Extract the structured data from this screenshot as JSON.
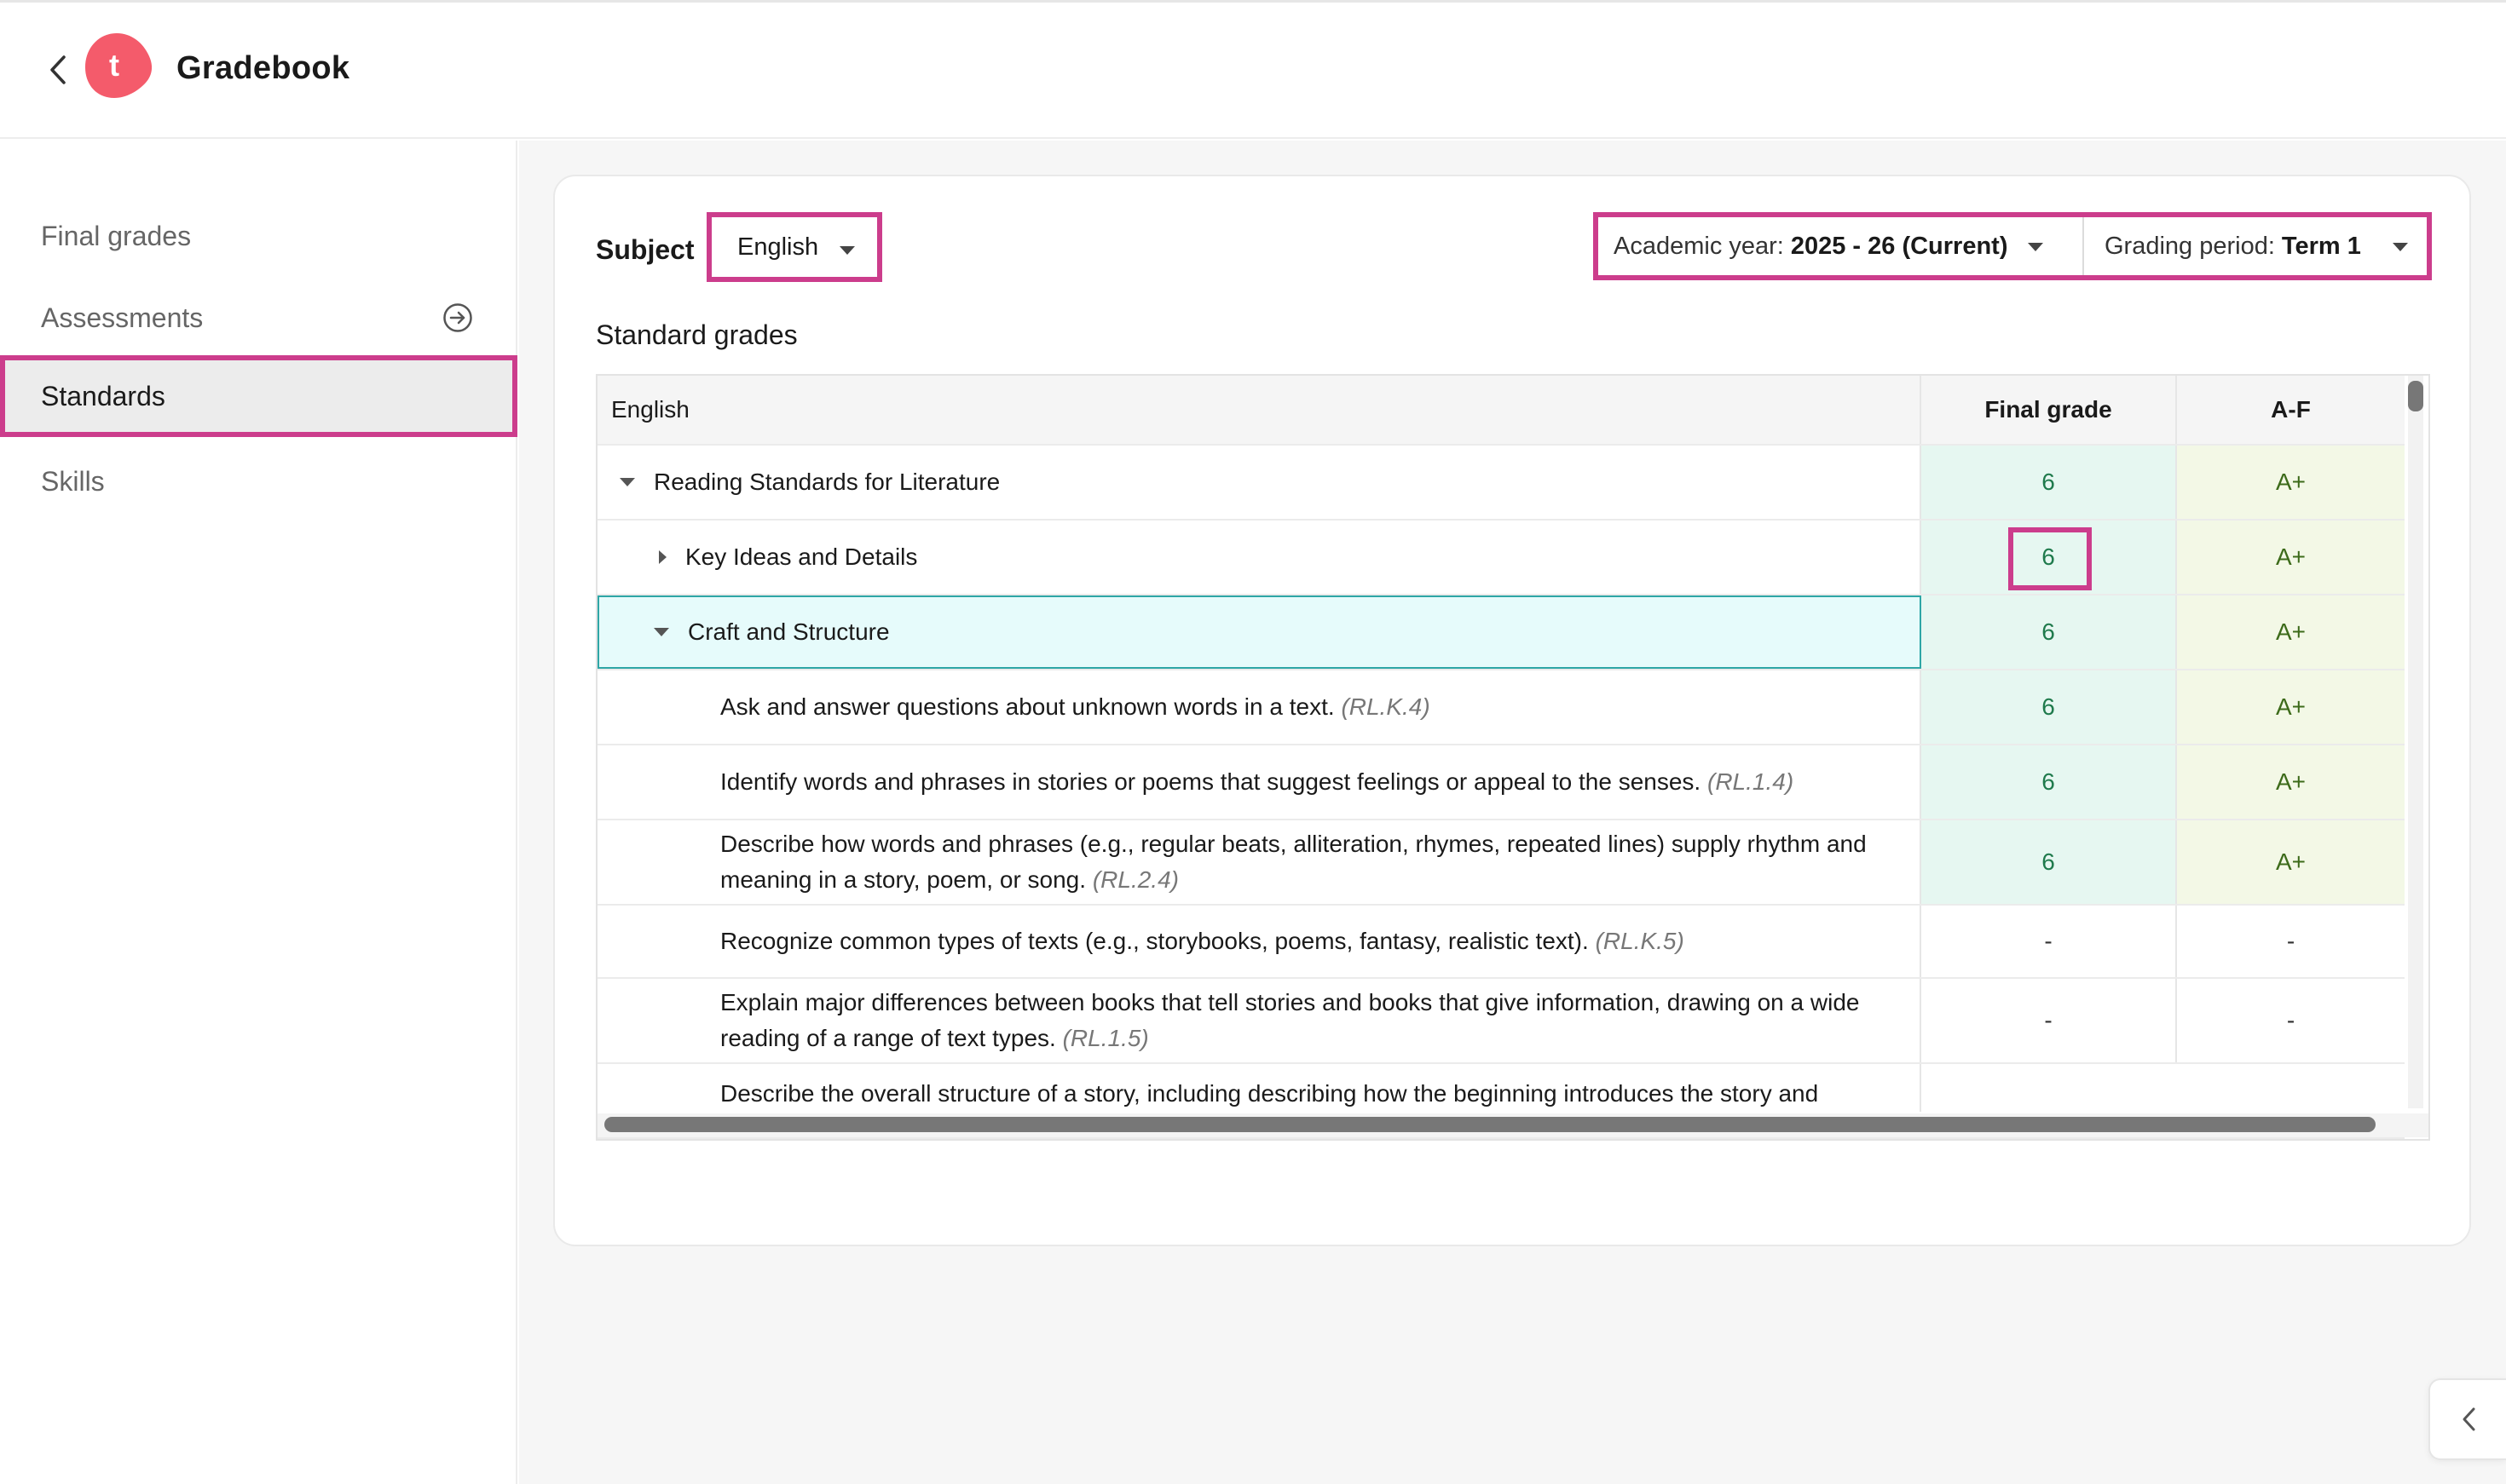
{
  "header": {
    "title": "Gradebook",
    "logo_letter": "t",
    "brand_color": "#f45b6b"
  },
  "sidebar": {
    "items": [
      {
        "label": "Final grades"
      },
      {
        "label": "Assessments",
        "icon": "arrow-right-circle-icon"
      },
      {
        "label": "Standards",
        "active": true
      },
      {
        "label": "Skills"
      }
    ]
  },
  "filters": {
    "subject_label": "Subject",
    "subject_value": "English",
    "academic_year_label": "Academic year:",
    "academic_year_value": "2025 - 26 (Current)",
    "grading_period_label": "Grading period:",
    "grading_period_value": "Term 1"
  },
  "section_title": "Standard grades",
  "table": {
    "headers": {
      "name": "English",
      "final": "Final grade",
      "af": "A-F"
    },
    "rows": [
      {
        "text": "Reading Standards for Literature",
        "code": "",
        "final": "6",
        "af": "A+"
      },
      {
        "text": "Key Ideas and Details",
        "code": "",
        "final": "6",
        "af": "A+"
      },
      {
        "text": "Craft and Structure",
        "code": "",
        "final": "6",
        "af": "A+"
      },
      {
        "text": "Ask and answer questions about unknown words in a text.",
        "code": "(RL.K.4)",
        "final": "6",
        "af": "A+"
      },
      {
        "text": "Identify words and phrases in stories or poems that suggest feelings or appeal to the senses.",
        "code": "(RL.1.4)",
        "final": "6",
        "af": "A+"
      },
      {
        "text": "Describe how words and phrases (e.g., regular beats, alliteration, rhymes, repeated lines) supply rhythm and meaning in a story, poem, or song.",
        "code": "(RL.2.4)",
        "final": "6",
        "af": "A+"
      },
      {
        "text": "Recognize common types of texts (e.g., storybooks, poems, fantasy, realistic text).",
        "code": "(RL.K.5)",
        "final": "-",
        "af": "-"
      },
      {
        "text": "Explain major differences between books that tell stories and books that give information, drawing on a wide reading of a range of text types.",
        "code": "(RL.1.5)",
        "final": "-",
        "af": "-"
      },
      {
        "text": "Describe the overall structure of a story, including describing how the beginning introduces the story and",
        "code": "",
        "final": "",
        "af": ""
      }
    ]
  },
  "colors": {
    "highlight": "#cc3d8c",
    "grade_bg": "#e6f7f1",
    "af_bg": "#f3f8e6",
    "selected_row": "#e6fbfb"
  }
}
